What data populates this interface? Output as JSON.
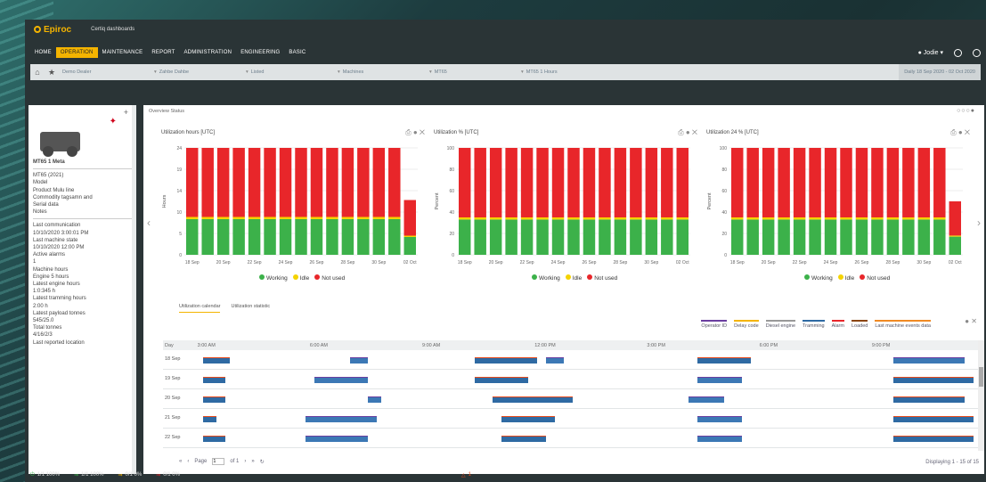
{
  "app": {
    "brand": "Epiroc",
    "title": "Certiq dashboards"
  },
  "nav": {
    "items": [
      "HOME",
      "OPERATION",
      "MAINTENANCE",
      "REPORT",
      "ADMINISTRATION",
      "ENGINEERING",
      "BASIC"
    ],
    "active_index": 1,
    "user": "Jodie"
  },
  "filters": {
    "items": [
      "Demo Dealer",
      "Zahbe Dahbe",
      "Listed",
      "Machines",
      "MT65",
      "MT65 1 Hours"
    ],
    "date_range": "Daily 18 Sep 2020 - 02 Oct 2020"
  },
  "left_panel": {
    "title": "MT65 1 Meta",
    "lines": [
      "MT65 (2021)",
      "Model",
      "Product Mulu line",
      "Commodity tagsamn and",
      "Serial data",
      "Notes",
      "Last communication",
      "10/10/2020 3:00:01 PM",
      "Last machine state",
      "10/10/2020 12:00 PM",
      "Active alarms",
      "1",
      "Machine hours",
      "Engine 5 hours",
      "Latest engine hours",
      "1:0:345 h",
      "Latest tramming hours",
      "2:00 h",
      "Latest payload tonnes",
      "545/25.0",
      "Total tonnes",
      "4/16/2/3",
      "Last reported location"
    ]
  },
  "main": {
    "breadcrumb": "Overview  Status",
    "charts_legend": {
      "working": "Working",
      "idle": "Idle",
      "not_used": "Not used"
    },
    "tabs": [
      "Utilization calendar",
      "Utilization statistic"
    ],
    "gantt_legend": [
      "Operator ID",
      "Delay code",
      "Diesel engine",
      "Tramming",
      "Alarm",
      "Loaded",
      "Last machine events data"
    ],
    "gantt_header": {
      "day": "Day",
      "times": [
        "3:00 AM",
        "6:00 AM",
        "9:00 AM",
        "12:00 PM",
        "3:00 PM",
        "6:00 PM",
        "9:00 PM"
      ]
    },
    "gantt_rows": [
      "18 Sep",
      "19 Sep",
      "20 Sep",
      "21 Sep",
      "22 Sep"
    ],
    "pager": {
      "page_label": "Page",
      "page": "1",
      "of_label": "of 1",
      "info": "Displaying 1 - 15 of 15"
    }
  },
  "colors": {
    "working": "#3cb14a",
    "idle": "#f4d300",
    "not_used": "#e8262a",
    "accent": "#f4b400"
  },
  "chart_data": [
    {
      "type": "bar",
      "title": "Utilization hours [UTC]",
      "ylabel": "Hours",
      "ylim": [
        0,
        24
      ],
      "x_ticks": [
        "18 Sep",
        "20 Sep",
        "22 Sep",
        "24 Sep",
        "26 Sep",
        "28 Sep",
        "30 Sep",
        "02 Oct"
      ],
      "categories": [
        "18 Sep",
        "19 Sep",
        "20 Sep",
        "21 Sep",
        "22 Sep",
        "23 Sep",
        "24 Sep",
        "25 Sep",
        "26 Sep",
        "27 Sep",
        "28 Sep",
        "29 Sep",
        "30 Sep",
        "01 Oct",
        "02 Oct"
      ],
      "series": [
        {
          "name": "Working",
          "values": [
            8,
            8,
            8,
            8,
            8,
            8,
            8,
            8,
            8,
            8,
            8,
            8,
            8,
            8,
            4
          ]
        },
        {
          "name": "Idle",
          "values": [
            0.5,
            0.5,
            0.5,
            0.5,
            0.5,
            0.5,
            0.5,
            0.5,
            0.5,
            0.5,
            0.5,
            0.5,
            0.5,
            0.5,
            0.3
          ]
        },
        {
          "name": "Not used",
          "values": [
            15.5,
            15.5,
            15.5,
            15.5,
            15.5,
            15.5,
            15.5,
            15.5,
            15.5,
            15.5,
            15.5,
            15.5,
            15.5,
            15.5,
            8
          ]
        }
      ]
    },
    {
      "type": "bar",
      "title": "Utilization % [UTC]",
      "ylabel": "Percent",
      "ylim": [
        0,
        100
      ],
      "x_ticks": [
        "18 Sep",
        "20 Sep",
        "22 Sep",
        "24 Sep",
        "26 Sep",
        "28 Sep",
        "30 Sep",
        "02 Oct"
      ],
      "categories": [
        "18 Sep",
        "19 Sep",
        "20 Sep",
        "21 Sep",
        "22 Sep",
        "23 Sep",
        "24 Sep",
        "25 Sep",
        "26 Sep",
        "27 Sep",
        "28 Sep",
        "29 Sep",
        "30 Sep",
        "01 Oct",
        "02 Oct"
      ],
      "series": [
        {
          "name": "Working",
          "values": [
            33,
            33,
            33,
            33,
            33,
            33,
            33,
            33,
            33,
            33,
            33,
            33,
            33,
            33,
            33
          ]
        },
        {
          "name": "Idle",
          "values": [
            2,
            2,
            2,
            2,
            2,
            2,
            2,
            2,
            2,
            2,
            2,
            2,
            2,
            2,
            2
          ]
        },
        {
          "name": "Not used",
          "values": [
            65,
            65,
            65,
            65,
            65,
            65,
            65,
            65,
            65,
            65,
            65,
            65,
            65,
            65,
            65
          ]
        }
      ]
    },
    {
      "type": "bar",
      "title": "Utilization 24 % [UTC]",
      "ylabel": "Percent",
      "ylim": [
        0,
        100
      ],
      "x_ticks": [
        "18 Sep",
        "20 Sep",
        "22 Sep",
        "24 Sep",
        "26 Sep",
        "28 Sep",
        "30 Sep",
        "02 Oct"
      ],
      "categories": [
        "18 Sep",
        "19 Sep",
        "20 Sep",
        "21 Sep",
        "22 Sep",
        "23 Sep",
        "24 Sep",
        "25 Sep",
        "26 Sep",
        "27 Sep",
        "28 Sep",
        "29 Sep",
        "30 Sep",
        "01 Oct",
        "02 Oct"
      ],
      "series": [
        {
          "name": "Working",
          "values": [
            33,
            33,
            33,
            33,
            33,
            33,
            33,
            33,
            33,
            33,
            33,
            33,
            33,
            33,
            17
          ]
        },
        {
          "name": "Idle",
          "values": [
            2,
            2,
            2,
            2,
            2,
            2,
            2,
            2,
            2,
            2,
            2,
            2,
            2,
            2,
            1
          ]
        },
        {
          "name": "Not used",
          "values": [
            65,
            65,
            65,
            65,
            65,
            65,
            65,
            65,
            65,
            65,
            65,
            65,
            65,
            65,
            32
          ]
        }
      ]
    }
  ],
  "status_bar": {
    "items": [
      "1/1 100%",
      "1/1 100%",
      "0/1 0%",
      "0/1 0%"
    ],
    "alarm_count": "1"
  }
}
